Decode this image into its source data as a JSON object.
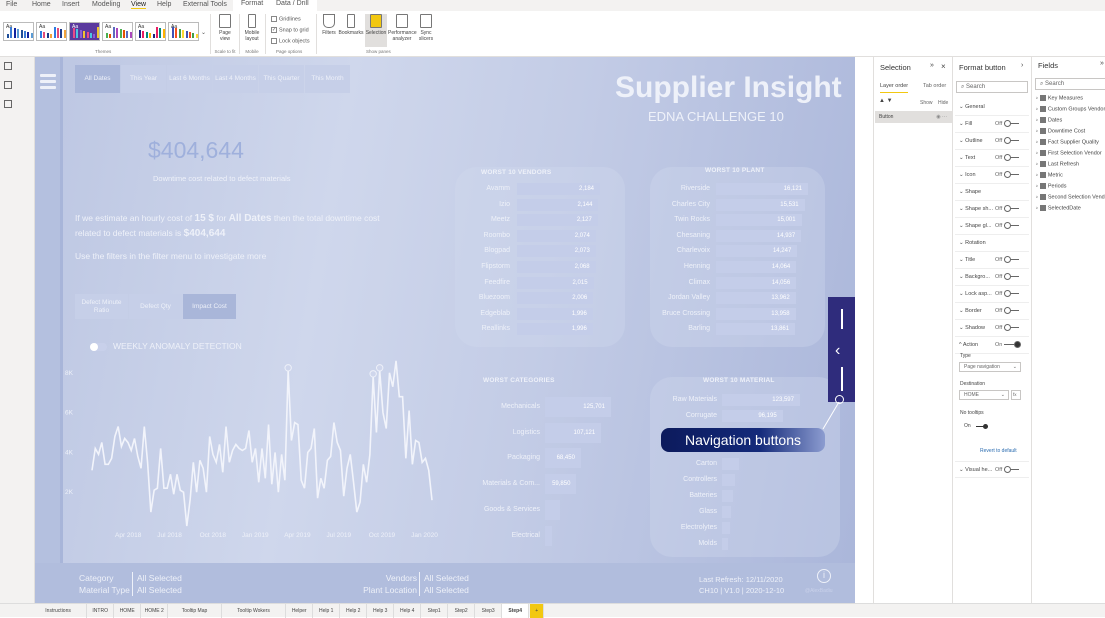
{
  "menu": {
    "tabs": [
      "File",
      "Home",
      "Insert",
      "Modeling",
      "View",
      "Help",
      "External Tools",
      "Format",
      "Data / Drill"
    ],
    "active": "View"
  },
  "ribbon": {
    "themes_label": "Themes",
    "page_view": "Page view",
    "scale_label": "Scale to fit",
    "mobile_layout": "Mobile layout",
    "mobile_label": "Mobile",
    "gridlines": "Gridlines",
    "snap": "Snap to grid",
    "lock": "Lock objects",
    "page_options": "Page options",
    "filters": "Filters",
    "bookmarks": "Bookmarks",
    "selection": "Selection",
    "performance": "Performance analyzer",
    "sync": "Sync slicers",
    "show_panes": "Show panes"
  },
  "report": {
    "title": "Supplier Insight",
    "subtitle": "EDNA CHALLENGE 10",
    "date_buttons": [
      "All Dates",
      "This Year",
      "Last 6 Months",
      "Last 4 Months",
      "This Quarter",
      "This Month"
    ],
    "selected_date": "All Dates",
    "kpi": "$404,644",
    "kpi_label": "Downtime cost related to defect materials",
    "narr_1": "If we estimate an hourly cost of ",
    "narr_cost": "15 $",
    "narr_2": " for ",
    "narr_period": "All Dates",
    "narr_3": " then the total downtime cost",
    "narr_4": "related to defect materials is ",
    "narr_total": "$404,644",
    "hint": "Use the filters in the filter menu to investigate more",
    "metric_buttons": [
      "Defect Minute Ratio",
      "Defect Qty",
      "Impact Cost"
    ],
    "selected_metric": "Impact Cost",
    "anomaly_label": "WEEKLY ANOMALY DETECTION",
    "vendors": {
      "title": "WORST 10 VENDORS",
      "items": [
        {
          "n": "Avamm",
          "v": 2184,
          "t": "2,184"
        },
        {
          "n": "Izio",
          "v": 2144,
          "t": "2,144"
        },
        {
          "n": "Meetz",
          "v": 2127,
          "t": "2,127"
        },
        {
          "n": "Roombo",
          "v": 2074,
          "t": "2,074"
        },
        {
          "n": "Blogpad",
          "v": 2073,
          "t": "2,073"
        },
        {
          "n": "Flipstorm",
          "v": 2068,
          "t": "2,068"
        },
        {
          "n": "Feedfire",
          "v": 2015,
          "t": "2,015"
        },
        {
          "n": "Bluezoom",
          "v": 2006,
          "t": "2,006"
        },
        {
          "n": "Edgeblab",
          "v": 1996,
          "t": "1,996"
        },
        {
          "n": "Reallinks",
          "v": 1996,
          "t": "1,996"
        }
      ]
    },
    "plants": {
      "title": "WORST 10 PLANT",
      "items": [
        {
          "n": "Riverside",
          "v": 16121,
          "t": "16,121"
        },
        {
          "n": "Charles City",
          "v": 15531,
          "t": "15,531"
        },
        {
          "n": "Twin Rocks",
          "v": 15001,
          "t": "15,001"
        },
        {
          "n": "Chesaning",
          "v": 14937,
          "t": "14,937"
        },
        {
          "n": "Charlevoix",
          "v": 14247,
          "t": "14,247"
        },
        {
          "n": "Henning",
          "v": 14064,
          "t": "14,064"
        },
        {
          "n": "Climax",
          "v": 14056,
          "t": "14,056"
        },
        {
          "n": "Jordan Valley",
          "v": 13962,
          "t": "13,962"
        },
        {
          "n": "Bruce Crossing",
          "v": 13958,
          "t": "13,958"
        },
        {
          "n": "Barling",
          "v": 13861,
          "t": "13,861"
        }
      ]
    },
    "categories": {
      "title": "WORST CATEGORIES",
      "items": [
        {
          "n": "Mechanicals",
          "v": 125701,
          "t": "125,701"
        },
        {
          "n": "Logistics",
          "v": 107121,
          "t": "107,121"
        },
        {
          "n": "Packaging",
          "v": 68450,
          "t": "68,450"
        },
        {
          "n": "Materials & Com...",
          "v": 59850,
          "t": "59,850"
        },
        {
          "n": "Goods & Services",
          "v": 28000,
          "t": ""
        },
        {
          "n": "Electrical",
          "v": 13000,
          "t": ""
        }
      ]
    },
    "materials": {
      "title": "WORST 10 MATERIAL",
      "items": [
        {
          "n": "Raw Materials",
          "v": 123597,
          "t": "123,597"
        },
        {
          "n": "Corrugate",
          "v": 96195,
          "t": "96,195"
        },
        {
          "n": "Carton",
          "v": 27000,
          "t": ""
        },
        {
          "n": "Controllers",
          "v": 21000,
          "t": ""
        },
        {
          "n": "Batteries",
          "v": 17000,
          "t": ""
        },
        {
          "n": "Glass",
          "v": 14000,
          "t": ""
        },
        {
          "n": "Electrolytes",
          "v": 13000,
          "t": ""
        },
        {
          "n": "Molds",
          "v": 10000,
          "t": ""
        }
      ]
    },
    "callout": "Navigation buttons",
    "footer": {
      "category_label": "Category",
      "category_value": "All Selected",
      "material_label": "Material Type",
      "material_value": "All Selected",
      "vendors_label": "Vendors",
      "vendors_value": "All Selected",
      "plant_label": "Plant Location",
      "plant_value": "All Selected",
      "refresh": "Last Refresh: 12/11/2020",
      "version": "CH10 | V1.0 | 2020-12-10",
      "credit": "@AlexBadiu"
    }
  },
  "chart_data": {
    "type": "line",
    "yticks": [
      "8K",
      "6K",
      "4K",
      "2K"
    ],
    "ylim": [
      0,
      8000
    ],
    "xticks": [
      "Apr 2018",
      "Jul 2018",
      "Oct 2018",
      "Jan 2019",
      "Apr 2019",
      "Jul 2019",
      "Oct 2019",
      "Jan 2020"
    ],
    "grid": false,
    "values": [
      3100,
      4200,
      3900,
      4500,
      3400,
      3400,
      3700,
      4800,
      5300,
      4300,
      4700,
      4500,
      4100,
      4700,
      3800,
      3200,
      5300,
      3500,
      1000,
      2100,
      2200,
      4200,
      2200,
      2200,
      2900,
      1900,
      2900,
      2100,
      2000,
      300,
      1600,
      3500,
      2000,
      3600,
      3200,
      2000,
      4800,
      3900,
      3500,
      4400,
      3000,
      5300,
      3500,
      4100,
      4400,
      4200,
      4100,
      4200,
      5100,
      3500,
      4200,
      2500,
      4200,
      2700,
      5400,
      2400,
      4000,
      2000,
      3900,
      2600,
      8100,
      4600,
      5500,
      5400,
      2600,
      2200,
      4000,
      4200,
      5200,
      1700,
      2700,
      2200,
      3600,
      3800,
      5500,
      4500,
      4100,
      1800,
      3200,
      3900,
      2500,
      1000,
      1500,
      3400,
      2500,
      3900,
      7800,
      5000,
      8100,
      6000,
      5200,
      8000,
      7300,
      8600,
      6800,
      6800,
      3700,
      6100,
      3400,
      4600,
      4500,
      3500,
      3700,
      3100,
      1600
    ],
    "anomalies": [
      60,
      86,
      88
    ]
  },
  "selection_pane": {
    "title": "Selection",
    "tabs": [
      "Layer order",
      "Tab order"
    ],
    "show": "Show",
    "hide": "Hide",
    "items": [
      "Button"
    ]
  },
  "format_pane": {
    "title": "Format button",
    "search": "Search",
    "rows": [
      {
        "l": "General"
      },
      {
        "l": "Fill",
        "s": "Off"
      },
      {
        "l": "Outline",
        "s": "Off"
      },
      {
        "l": "Text",
        "s": "Off"
      },
      {
        "l": "Icon",
        "s": "Off"
      },
      {
        "l": "Shape"
      },
      {
        "l": "Shape sh...",
        "s": "Off"
      },
      {
        "l": "Shape gl...",
        "s": "Off"
      },
      {
        "l": "Rotation"
      },
      {
        "l": "Title",
        "s": "Off"
      },
      {
        "l": "Backgro...",
        "s": "Off"
      },
      {
        "l": "Lock asp...",
        "s": "Off"
      },
      {
        "l": "Border",
        "s": "Off"
      },
      {
        "l": "Shadow",
        "s": "Off"
      },
      {
        "l": "Action",
        "s": "On"
      }
    ],
    "type_label": "Type",
    "type_value": "Page navigation",
    "dest_label": "Destination",
    "dest_value": "HOME",
    "tooltips_label": "No tooltips",
    "tooltips_state": "On",
    "revert": "Revert to default",
    "visual_header": "Visual he...",
    "visual_header_state": "Off"
  },
  "fields_pane": {
    "title": "Fields",
    "search": "Search",
    "items": [
      "Key Measures",
      "Custom Groups Vendor",
      "Dates",
      "Downtime Cost",
      "Fact Supplier Quality",
      "First Selection Vendor",
      "Last Refresh",
      "Metric",
      "Periods",
      "Second Selection Vendor",
      "SelectedDate"
    ]
  },
  "page_tabs": {
    "tabs": [
      "Instructions",
      "INTRO",
      "HOME",
      "HOME 2",
      "Tooltip Map",
      "Tooltip Wokers",
      "Helper",
      "Help 1",
      "Help 2",
      "Help 3",
      "Help 4",
      "Step1",
      "Step2",
      "Step3",
      "Step4"
    ],
    "active": "Step4",
    "add": "+"
  }
}
